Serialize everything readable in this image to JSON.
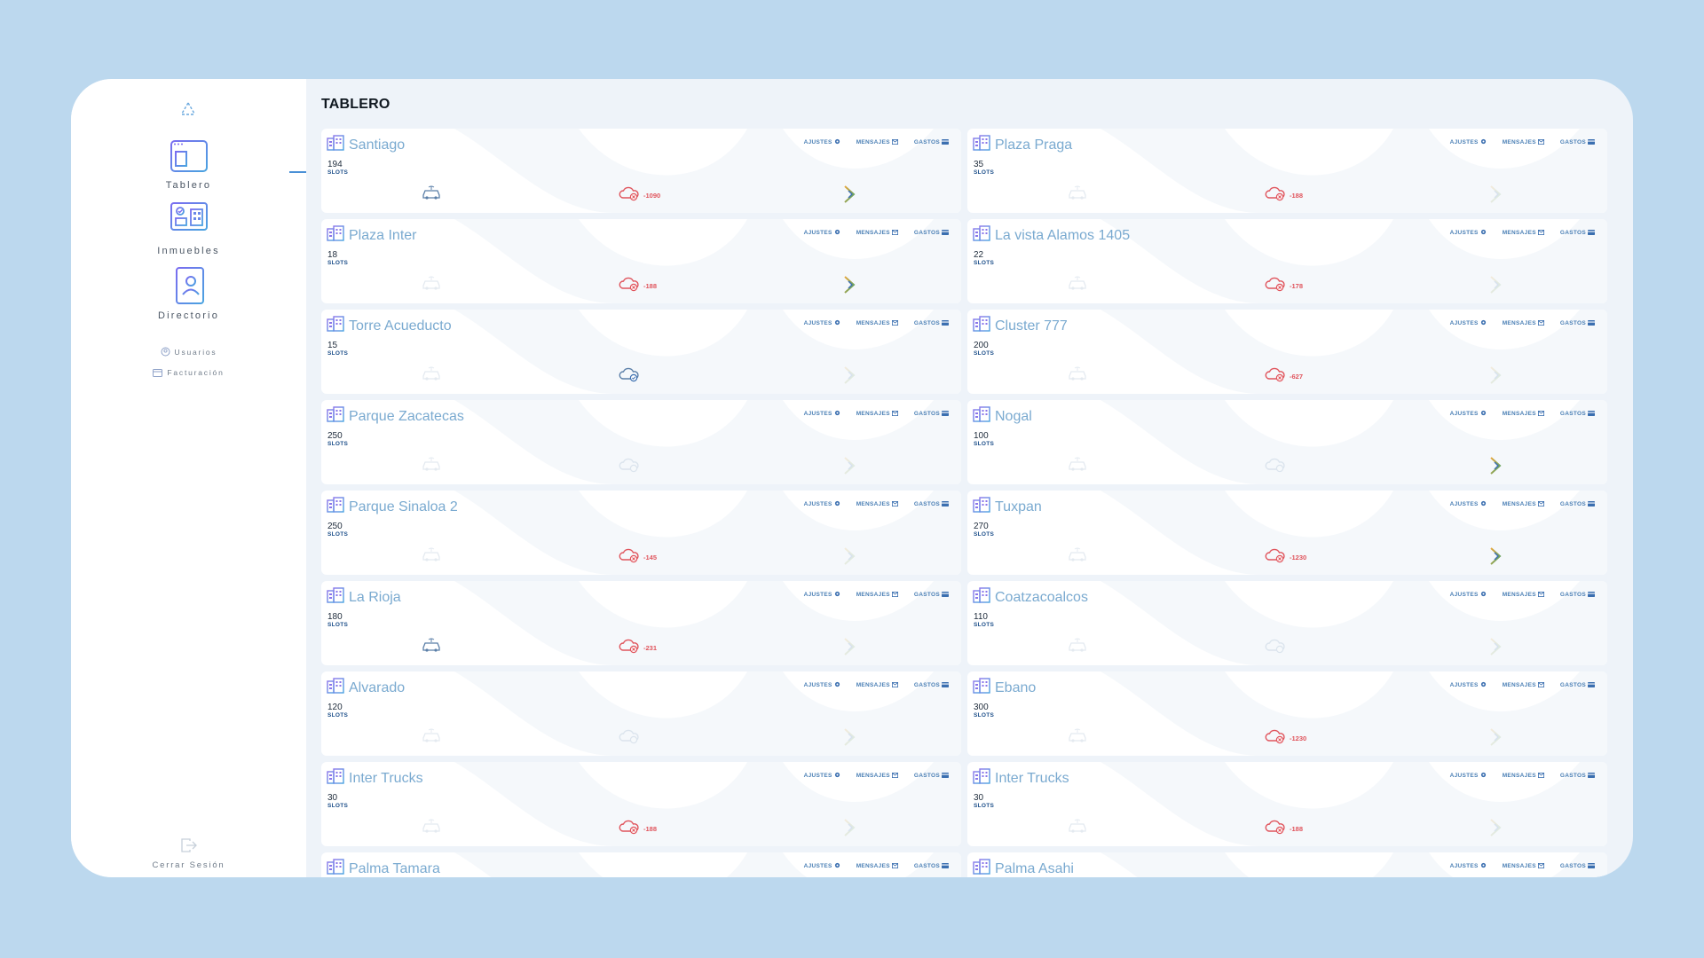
{
  "sidebar": {
    "nav": [
      {
        "label": "Tablero",
        "icon": "dashboard-icon"
      },
      {
        "label": "Inmuebles",
        "icon": "buildings-monitor-icon"
      },
      {
        "label": "Directorio",
        "icon": "contact-book-icon"
      }
    ],
    "links": [
      {
        "label": "Usuarios",
        "icon": "users-icon"
      },
      {
        "label": "Facturación",
        "icon": "billing-icon"
      }
    ],
    "logout": "Cerrar Sesión"
  },
  "page": {
    "title": "TABLERO"
  },
  "labels": {
    "slots": "SLOTS",
    "ajustes": "AJUSTES",
    "mensajes": "MENSAJES",
    "gastos": "GASTOS"
  },
  "colors": {
    "accent": "#4a90d6",
    "negative": "#e0545c",
    "name": "#7aaad0",
    "background": "#bcd8ee"
  },
  "properties": [
    {
      "name": "Santiago",
      "slots": "194",
      "car": true,
      "cloud": "alert",
      "cloud_value": "-1090",
      "ai": true
    },
    {
      "name": "Plaza Praga",
      "slots": "35",
      "car": false,
      "cloud": "alert",
      "cloud_value": "-188",
      "ai": false
    },
    {
      "name": "Plaza Inter",
      "slots": "18",
      "car": false,
      "cloud": "alert",
      "cloud_value": "-188",
      "ai": true
    },
    {
      "name": "La vista Alamos 1405",
      "slots": "22",
      "car": false,
      "cloud": "alert",
      "cloud_value": "-178",
      "ai": false
    },
    {
      "name": "Torre Acueducto",
      "slots": "15",
      "car": false,
      "cloud": "ok",
      "cloud_value": "",
      "ai": false
    },
    {
      "name": "Cluster 777",
      "slots": "200",
      "car": false,
      "cloud": "alert",
      "cloud_value": "-627",
      "ai": false
    },
    {
      "name": "Parque Zacatecas",
      "slots": "250",
      "car": false,
      "cloud": "off",
      "cloud_value": "",
      "ai": false
    },
    {
      "name": "Nogal",
      "slots": "100",
      "car": false,
      "cloud": "off",
      "cloud_value": "",
      "ai": true
    },
    {
      "name": "Parque Sinaloa 2",
      "slots": "250",
      "car": false,
      "cloud": "alert",
      "cloud_value": "-145",
      "ai": false
    },
    {
      "name": "Tuxpan",
      "slots": "270",
      "car": false,
      "cloud": "alert",
      "cloud_value": "-1230",
      "ai": true
    },
    {
      "name": "La Rioja",
      "slots": "180",
      "car": true,
      "cloud": "alert",
      "cloud_value": "-231",
      "ai": false
    },
    {
      "name": "Coatzacoalcos",
      "slots": "110",
      "car": false,
      "cloud": "off",
      "cloud_value": "",
      "ai": false
    },
    {
      "name": "Alvarado",
      "slots": "120",
      "car": false,
      "cloud": "off",
      "cloud_value": "",
      "ai": false
    },
    {
      "name": "Ebano",
      "slots": "300",
      "car": false,
      "cloud": "alert",
      "cloud_value": "-1230",
      "ai": false
    },
    {
      "name": "Inter Trucks",
      "slots": "30",
      "car": false,
      "cloud": "alert",
      "cloud_value": "-188",
      "ai": false
    },
    {
      "name": "Inter Trucks",
      "slots": "30",
      "car": false,
      "cloud": "alert",
      "cloud_value": "-188",
      "ai": false
    },
    {
      "name": "Palma Tamara",
      "slots": "",
      "car": false,
      "cloud": "off",
      "cloud_value": "",
      "ai": false
    },
    {
      "name": "Palma Asahi",
      "slots": "",
      "car": false,
      "cloud": "off",
      "cloud_value": "",
      "ai": false
    }
  ]
}
